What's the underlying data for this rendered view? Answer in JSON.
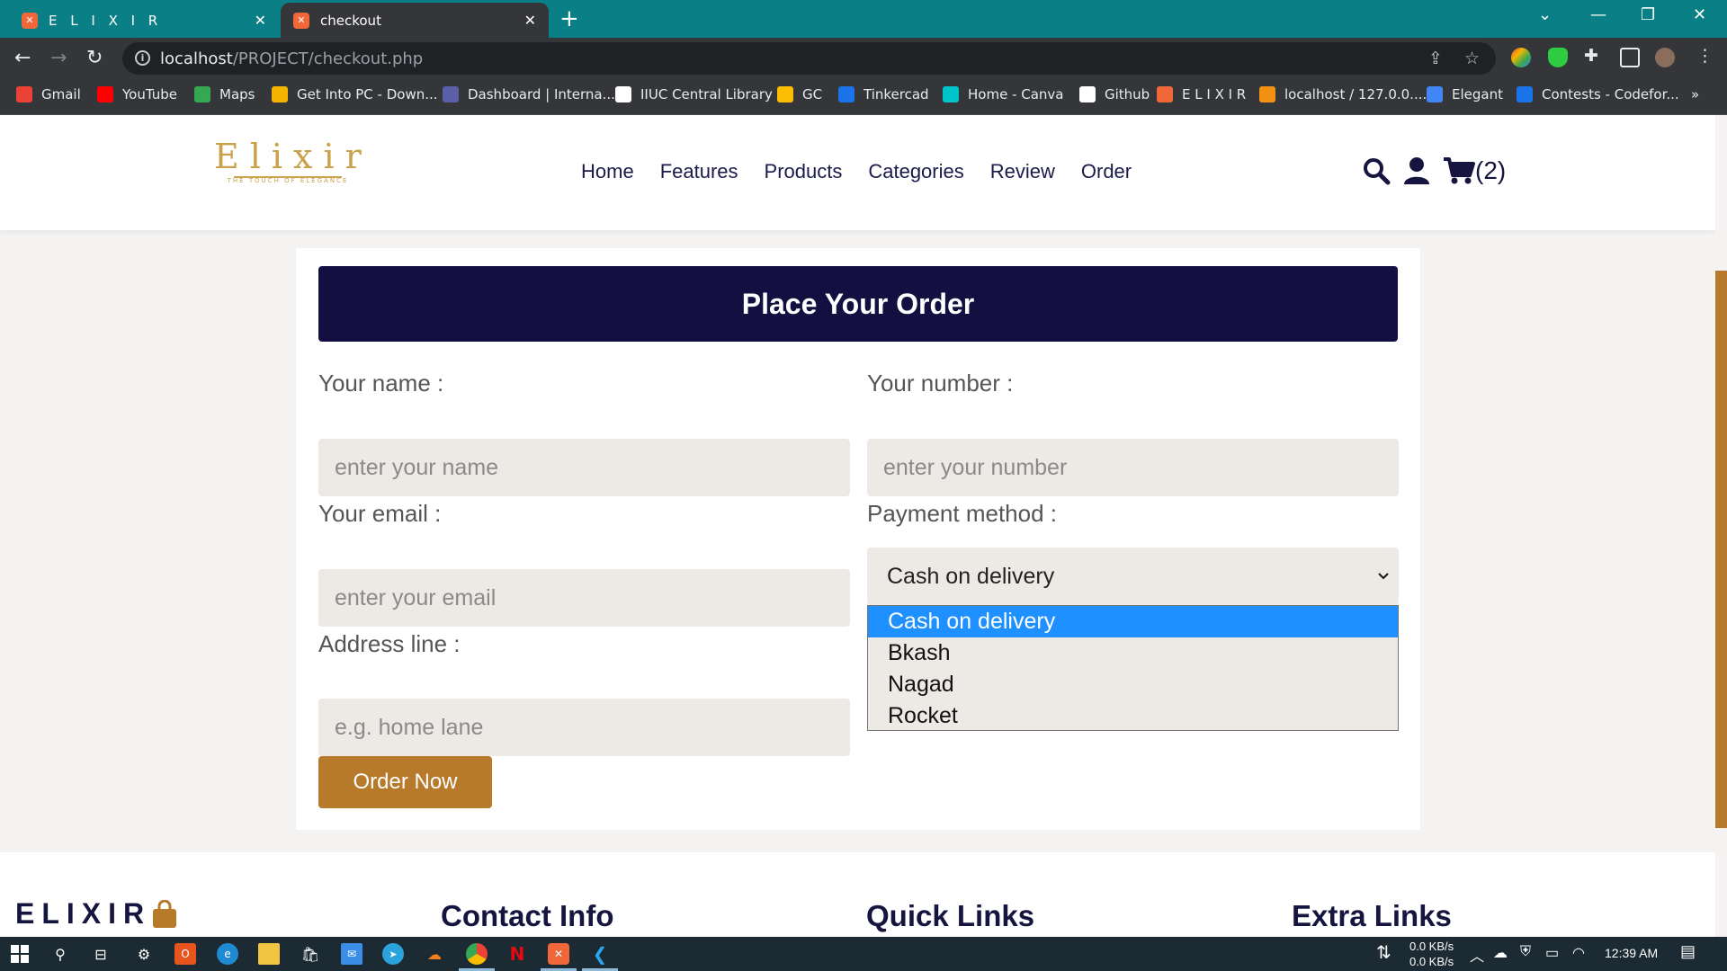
{
  "browser": {
    "tabs": [
      {
        "title": "E L I X I R",
        "active": false
      },
      {
        "title": "checkout",
        "active": true
      }
    ],
    "url_host": "localhost",
    "url_path": "/PROJECT/checkout.php",
    "bookmarks": [
      {
        "label": "Gmail",
        "icon": "gmail-icon",
        "color": "#ea4335"
      },
      {
        "label": "YouTube",
        "icon": "youtube-icon",
        "color": "#ff0000"
      },
      {
        "label": "Maps",
        "icon": "maps-icon",
        "color": "#34a853"
      },
      {
        "label": "Get Into PC - Down...",
        "icon": "getintopc-icon",
        "color": "#f4b400"
      },
      {
        "label": "Dashboard | Interna...",
        "icon": "dashboard-icon",
        "color": "#5b5fa8"
      },
      {
        "label": "IIUC Central Library",
        "icon": "library-icon",
        "color": "#ffffff"
      },
      {
        "label": "GC",
        "icon": "classroom-icon",
        "color": "#fbbc04"
      },
      {
        "label": "Tinkercad",
        "icon": "tinkercad-icon",
        "color": "#1a73e8"
      },
      {
        "label": "Home - Canva",
        "icon": "canva-icon",
        "color": "#00c4cc"
      },
      {
        "label": "Github",
        "icon": "github-icon",
        "color": "#ffffff"
      },
      {
        "label": "E L I X I R",
        "icon": "xampp-icon",
        "color": "#f0683a"
      },
      {
        "label": "localhost / 127.0.0....",
        "icon": "phpmyadmin-icon",
        "color": "#f29111"
      },
      {
        "label": "Elegant",
        "icon": "elegant-icon",
        "color": "#4285f4"
      },
      {
        "label": "Contests - Codefor...",
        "icon": "codeforces-icon",
        "color": "#1a73e8"
      }
    ],
    "more": "»"
  },
  "site": {
    "logo_word": "Elixir",
    "logo_tag": "THE TOUCH OF ELEGANCE",
    "nav": [
      "Home",
      "Features",
      "Products",
      "Categories",
      "Review",
      "Order"
    ],
    "cart_count": "(2)",
    "colors": {
      "navy": "#140f41",
      "gold": "#b7792a",
      "input_bg": "#edeae6",
      "select_highlight": "#1e90ff"
    }
  },
  "form": {
    "title": "Place Your Order",
    "name_label": "Your name :",
    "name_placeholder": "enter your name",
    "number_label": "Your number :",
    "number_placeholder": "enter your number",
    "email_label": "Your email :",
    "email_placeholder": "enter your email",
    "payment_label": "Payment method :",
    "payment_selected": "Cash on delivery",
    "payment_options": [
      "Cash on delivery",
      "Bkash",
      "Nagad",
      "Rocket"
    ],
    "address_label": "Address line :",
    "address_placeholder": "e.g. home lane",
    "submit": "Order Now"
  },
  "footer": {
    "brand": "ELIXIR",
    "headings": [
      "Contact Info",
      "Quick Links",
      "Extra Links"
    ]
  },
  "taskbar": {
    "net_down": "0.0 KB/s",
    "net_up": "0.0 KB/s",
    "time": "12:39 AM"
  }
}
